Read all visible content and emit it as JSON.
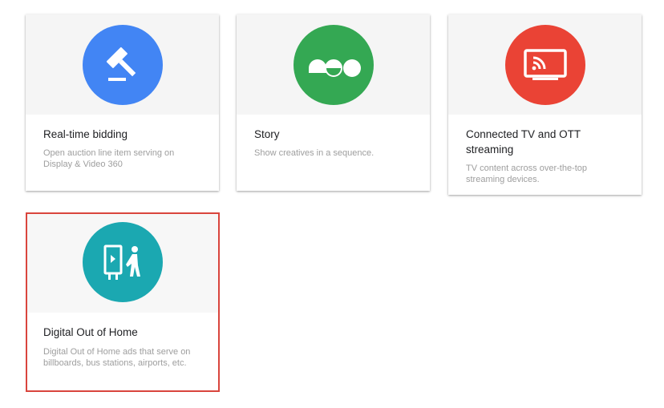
{
  "cards": [
    {
      "title": "Real-time bidding",
      "description": "Open auction line item serving on Display & Video 360",
      "icon": "gavel-icon",
      "color": "#4285f4"
    },
    {
      "title": "Story",
      "description": "Show creatives in a sequence.",
      "icon": "story-sequence-icon",
      "color": "#34a853"
    },
    {
      "title": "Connected TV and OTT streaming",
      "description": "TV content across over-the-top streaming devices.",
      "icon": "cast-tv-icon",
      "color": "#ea4335"
    },
    {
      "title": "Digital Out of Home",
      "description": "Digital Out of Home ads that serve on billboards, bus stations, airports, etc.",
      "icon": "billboard-person-icon",
      "color": "#1ba8b1",
      "selected": true
    }
  ],
  "selection_outline_color": "#d9453d"
}
